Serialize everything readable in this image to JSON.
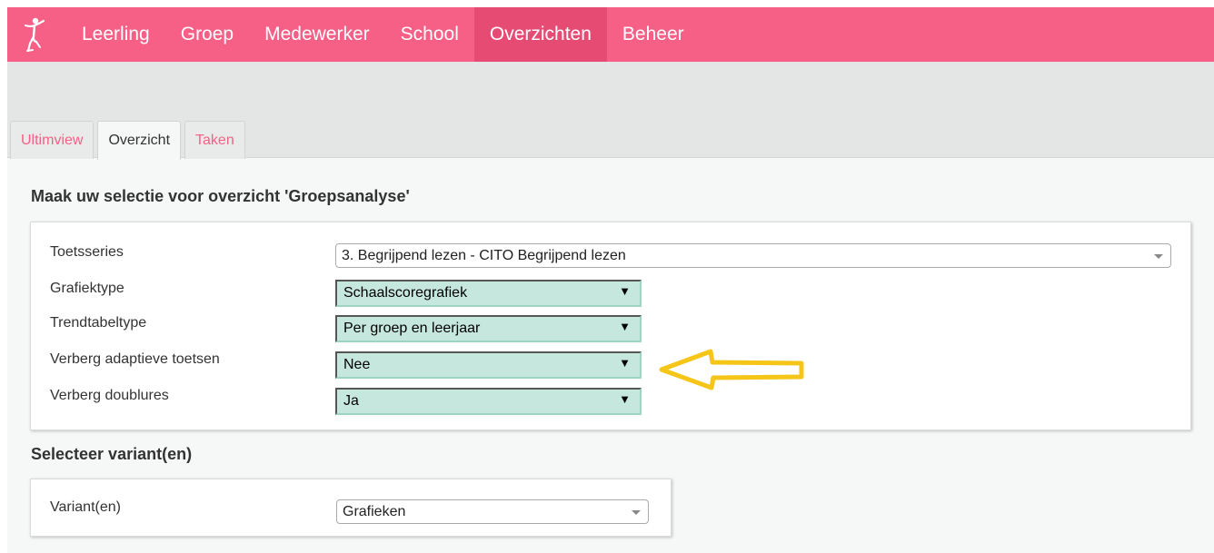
{
  "nav": {
    "logo_icon": "dancer-logo-icon",
    "items": [
      "Leerling",
      "Groep",
      "Medewerker",
      "School",
      "Overzichten",
      "Beheer"
    ],
    "active_index": 4
  },
  "tabs": {
    "items": [
      "Ultimview",
      "Overzicht",
      "Taken"
    ],
    "active_index": 1
  },
  "selection": {
    "heading": "Maak uw selectie voor overzicht 'Groepsanalyse'",
    "fields": [
      {
        "label": "Toetsseries",
        "value": "3. Begrijpend lezen - CITO Begrijpend lezen"
      },
      {
        "label": "Grafiektype",
        "value": "Schaalscoregrafiek"
      },
      {
        "label": "Trendtabeltype",
        "value": "Per groep en leerjaar"
      },
      {
        "label": "Verberg adaptieve toetsen",
        "value": "Nee"
      },
      {
        "label": "Verberg doublures",
        "value": "Ja"
      }
    ]
  },
  "variants": {
    "heading": "Selecteer variant(en)",
    "label": "Variant(en)",
    "value": "Grafieken"
  },
  "colors": {
    "brand_pink": "#f65f86",
    "active_nav": "#e64b74",
    "select_green": "#c6e7dd",
    "highlight_arrow": "#f5c518"
  },
  "annotation_icon": "yellow-arrow-icon"
}
